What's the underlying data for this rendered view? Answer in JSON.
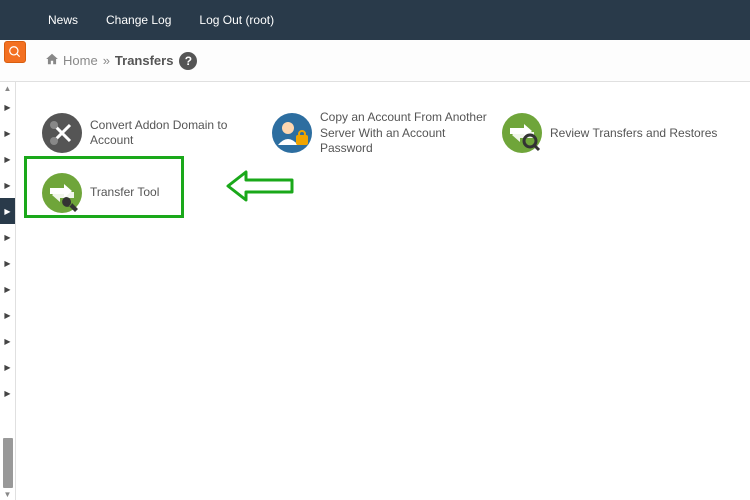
{
  "nav": {
    "news": "News",
    "changelog": "Change Log",
    "logout": "Log Out (root)"
  },
  "breadcrumb": {
    "home": "Home",
    "sep": "»",
    "current": "Transfers"
  },
  "help": "?",
  "tools": {
    "convert": "Convert Addon Domain to Account",
    "copy": "Copy an Account From Another Server With an Account Password",
    "review": "Review Transfers and Restores",
    "transfer_tool": "Transfer Tool"
  },
  "colors": {
    "navbg": "#293a4a",
    "orange": "#f37021",
    "green_icon": "#6fa53a",
    "darkgreen_icon": "#5a8c2f",
    "highlight": "#1aa81a"
  }
}
